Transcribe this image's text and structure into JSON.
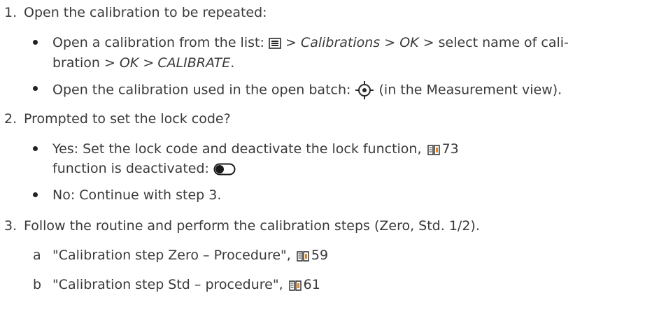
{
  "steps": [
    {
      "number": "1.",
      "text": "Open the calibration to be repeated:",
      "bullets": [
        {
          "line1": {
            "pre": "Open a calibration from the list:",
            "sep1": ">",
            "calibrations": "Calibrations",
            "sep2": ">",
            "ok1": "OK",
            "mid": "> select name of cali-"
          },
          "line2": {
            "pre": "bration >",
            "ok2": "OK",
            "sep": ">",
            "calibrate": "CALIBRATE",
            "end": "."
          }
        },
        {
          "pre": "Open the calibration used in the open batch:",
          "post": "(in the Measurement view)."
        }
      ]
    },
    {
      "number": "2.",
      "text": "Prompted to set the lock code?",
      "bullets": [
        {
          "line1": "Yes: Set the lock code and deactivate the lock function,",
          "page": "73",
          "line2": "function is deactivated:"
        },
        {
          "text": "No: Continue with step 3."
        }
      ]
    },
    {
      "number": "3.",
      "text": "Follow the routine and perform the calibration steps (Zero, Std. 1/2).",
      "substeps": [
        {
          "letter": "a",
          "text": "\"Calibration step Zero – Procedure\",",
          "page": "59"
        },
        {
          "letter": "b",
          "text": "\"Calibration step Std – procedure\",",
          "page": "61"
        }
      ]
    }
  ],
  "icons": {
    "menu": "menu-list-icon",
    "target": "crosshair-target-icon",
    "toggle": "toggle-off-icon",
    "book": "manual-book-icon"
  },
  "colors": {
    "text": "#3a3a3a",
    "book_accent": "#e08a1e"
  }
}
